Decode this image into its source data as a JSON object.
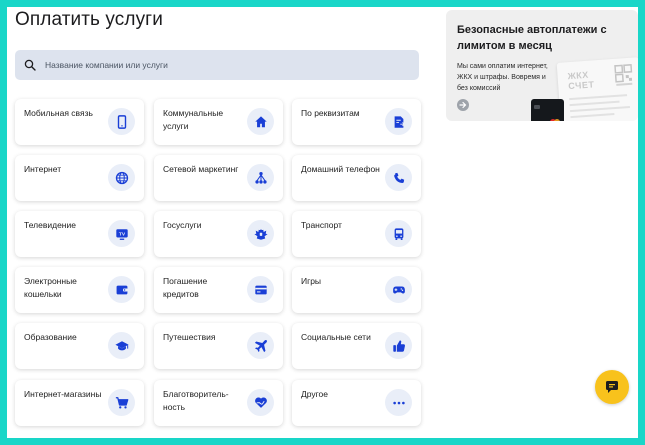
{
  "page": {
    "title": "Оплатить услуги",
    "search_placeholder": "Название компании или услуги"
  },
  "services": [
    {
      "label": "Мобильная связь",
      "icon": "phone-icon"
    },
    {
      "label": "Коммунальные услуги",
      "icon": "home-icon"
    },
    {
      "label": "По реквизитам",
      "icon": "invoice-icon"
    },
    {
      "label": "Интернет",
      "icon": "globe-icon"
    },
    {
      "label": "Сетевой маркетинг",
      "icon": "network-icon"
    },
    {
      "label": "Домашний телефон",
      "icon": "handset-icon"
    },
    {
      "label": "Телевидение",
      "icon": "tv-icon"
    },
    {
      "label": "Госуслуги",
      "icon": "coat-of-arms-icon"
    },
    {
      "label": "Транспорт",
      "icon": "bus-icon"
    },
    {
      "label": "Электронные кошельки",
      "icon": "wallet-icon"
    },
    {
      "label": "Погашение кредитов",
      "icon": "credit-card-icon"
    },
    {
      "label": "Игры",
      "icon": "gamepad-icon"
    },
    {
      "label": "Образование",
      "icon": "graduation-cap-icon"
    },
    {
      "label": "Путешествия",
      "icon": "airplane-icon"
    },
    {
      "label": "Социальные сети",
      "icon": "thumbs-up-icon"
    },
    {
      "label": "Интернет-магазины",
      "icon": "cart-icon"
    },
    {
      "label": "Благотворитель-ность",
      "icon": "heart-hand-icon"
    },
    {
      "label": "Другое",
      "icon": "more-icon"
    }
  ],
  "promo": {
    "title": "Безопасные автоплатежи с лимитом в месяц",
    "text": "Мы сами оплатим интернет, ЖКХ и штрафы. Вовремя и без комиссий",
    "receipt_text": "ЖКХ СЧЕТ"
  },
  "colors": {
    "accent": "#1a3fd6",
    "icon_bg": "#e9eef8",
    "chat": "#f8c21c",
    "frame": "#19d6c8"
  },
  "chat": {
    "icon": "chat-icon"
  }
}
